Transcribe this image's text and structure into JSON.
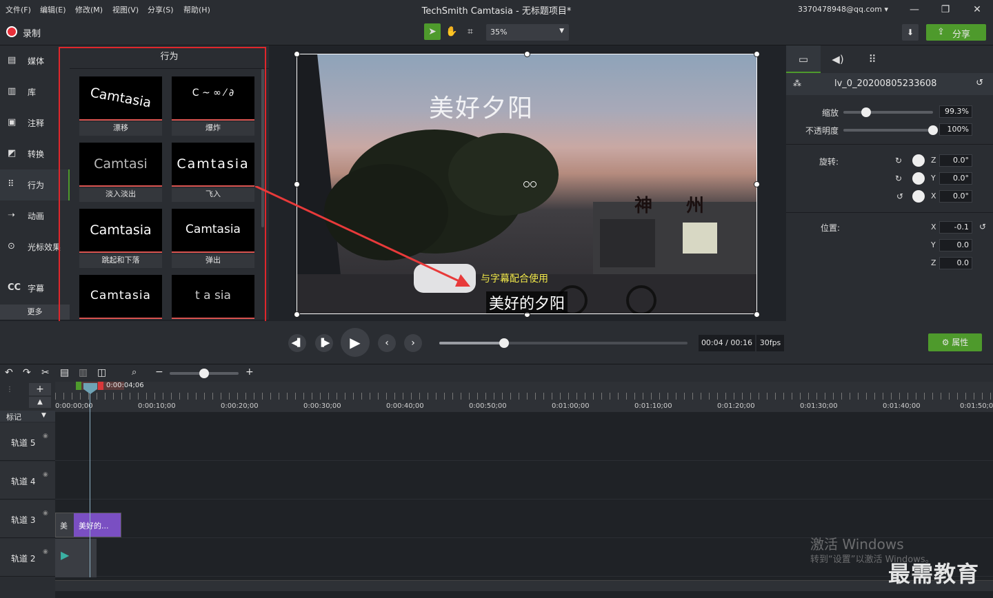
{
  "menu": [
    "文件(F)",
    "编辑(E)",
    "修改(M)",
    "视图(V)",
    "分享(S)",
    "帮助(H)"
  ],
  "window_title": "TechSmith Camtasia - 无标题项目*",
  "account": "3370478948@qq.com ▾",
  "toolbar": {
    "record_label": "录制",
    "zoom_value": "35%",
    "share_label": "分享"
  },
  "nav": [
    {
      "label": "媒体",
      "icon": "film-icon"
    },
    {
      "label": "库",
      "icon": "library-icon"
    },
    {
      "label": "注释",
      "icon": "annotation-icon"
    },
    {
      "label": "转换",
      "icon": "transition-icon"
    },
    {
      "label": "行为",
      "icon": "behavior-icon"
    },
    {
      "label": "动画",
      "icon": "animation-icon"
    },
    {
      "label": "光标效果",
      "icon": "cursor-icon"
    },
    {
      "label": "字幕",
      "icon": "cc-icon"
    }
  ],
  "nav_more": "更多",
  "panel": {
    "title": "行为",
    "tiles": [
      {
        "preview": "Camtasia",
        "label": "漂移"
      },
      {
        "preview": "C ~ ∞ ⁄ ∂",
        "label": "爆炸"
      },
      {
        "preview": "Camtasi",
        "label": "淡入淡出"
      },
      {
        "preview": "Camtasia",
        "label": "飞入"
      },
      {
        "preview": "Camtasia",
        "label": "跳起和下落"
      },
      {
        "preview": "Camtasia",
        "label": "弹出"
      },
      {
        "preview": "Camtasia",
        "label": ""
      },
      {
        "preview": "t  a  sia",
        "label": ""
      }
    ]
  },
  "canvas": {
    "video_title": "美好夕阳",
    "caption_hint": "与字幕配合使用",
    "caption_main": "美好的夕阳",
    "sign_text": "神 州"
  },
  "props": {
    "clip_name": "lv_0_20200805233608",
    "scale_label": "缩放",
    "scale_value": "99.3%",
    "scale_fraction": 0.25,
    "opacity_label": "不透明度",
    "opacity_value": "100%",
    "opacity_fraction": 1.0,
    "rotation_label": "旋转:",
    "rotation": [
      {
        "axis": "Z",
        "value": "0.0°"
      },
      {
        "axis": "Y",
        "value": "0.0°"
      },
      {
        "axis": "X",
        "value": "0.0°"
      }
    ],
    "position_label": "位置:",
    "position": [
      {
        "axis": "X",
        "value": "-0.1"
      },
      {
        "axis": "Y",
        "value": "0.0"
      },
      {
        "axis": "Z",
        "value": "0.0"
      }
    ]
  },
  "playback": {
    "timecode": "00:04 / 00:16",
    "fps": "30fps",
    "progress_fraction": 0.26,
    "props_button": "属性"
  },
  "timeline": {
    "playhead_time": "0:00:04;06",
    "marker_label": "标记",
    "ticks": [
      "0:00:00;00",
      "0:00:10;00",
      "0:00:20;00",
      "0:00:30;00",
      "0:00:40;00",
      "0:00:50;00",
      "0:01:00;00",
      "0:01:10;00",
      "0:01:20;00",
      "0:01:30;00",
      "0:01:40;00",
      "0:01:50;00"
    ],
    "tracks": [
      "轨道 5",
      "轨道 4",
      "轨道 3",
      "轨道 2"
    ],
    "clip_track3_prefix": "美",
    "clip_track3_label": "美好的..."
  },
  "watermark": {
    "line1": "激活 Windows",
    "line2": "转到“设置”以激活 Windows。",
    "brand": "最需教育"
  }
}
